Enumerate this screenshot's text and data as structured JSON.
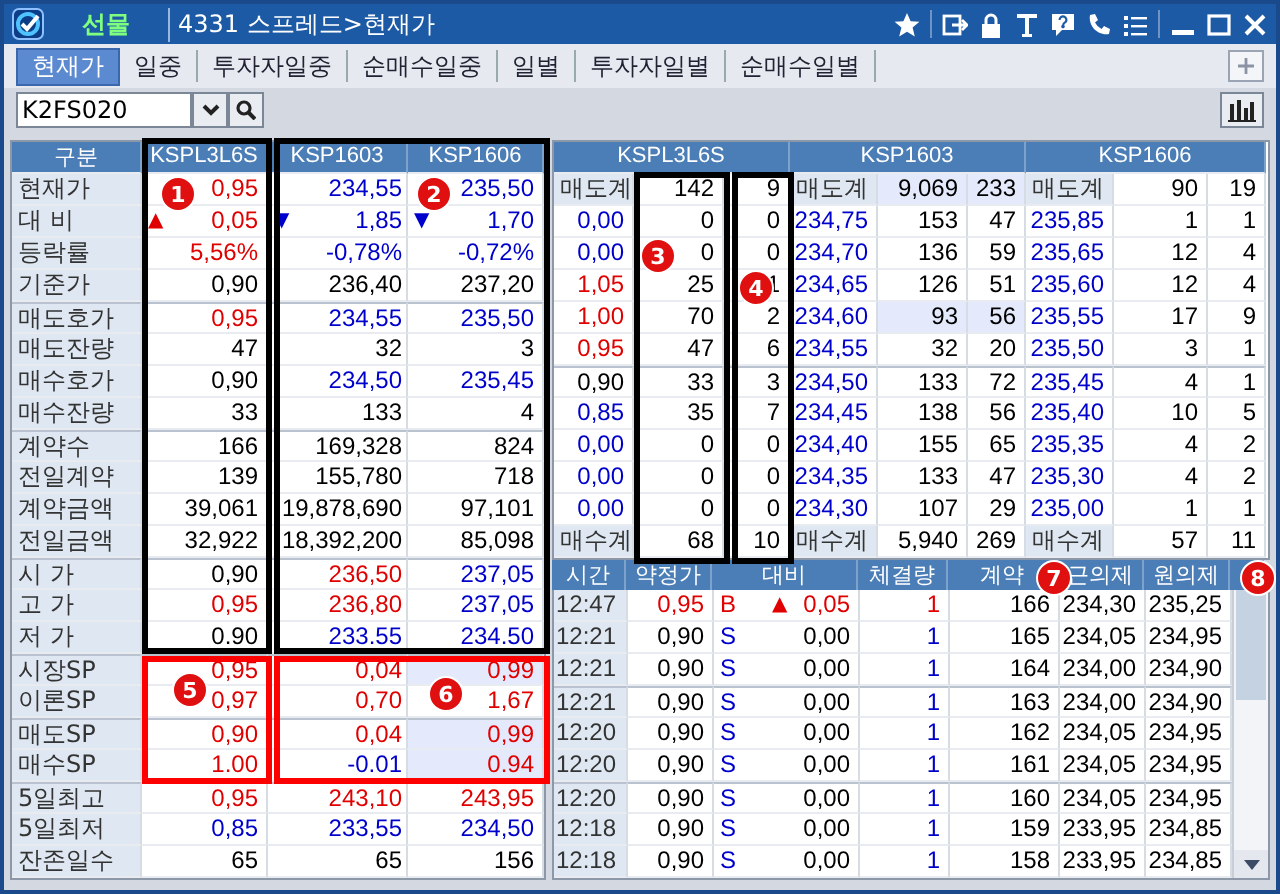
{
  "window": {
    "market": "선물",
    "title": "4331 스프레드>현재가"
  },
  "tabs": [
    {
      "label": "현재가",
      "selected": true
    },
    {
      "label": "일중",
      "selected": false
    },
    {
      "label": "투자자일중",
      "selected": false
    },
    {
      "label": "순매수일중",
      "selected": false
    },
    {
      "label": "일별",
      "selected": false
    },
    {
      "label": "투자자일별",
      "selected": false
    },
    {
      "label": "순매수일별",
      "selected": false
    }
  ],
  "toolbar": {
    "code": "K2FS020"
  },
  "quote_table": {
    "corner": "구분",
    "columns": [
      "KSPL3L6S",
      "KSP1603",
      "KSP1606"
    ],
    "rows": [
      {
        "label": "현재가",
        "cells": [
          {
            "text": "0,95",
            "color": "#e00000"
          },
          {
            "text": "234,55",
            "color": "#0000cc"
          },
          {
            "text": "235,50",
            "color": "#0000cc"
          }
        ]
      },
      {
        "label": "대 비",
        "cells": [
          {
            "text": "0,05",
            "color": "#e00000",
            "arrow": "▲"
          },
          {
            "text": "1,85",
            "color": "#0000cc",
            "arrow": "▼"
          },
          {
            "text": "1,70",
            "color": "#0000cc",
            "arrow": "▼"
          }
        ]
      },
      {
        "label": "등락률",
        "cells": [
          {
            "text": "5,56%",
            "color": "#e00000"
          },
          {
            "text": "-0,78%",
            "color": "#0000cc"
          },
          {
            "text": "-0,72%",
            "color": "#0000cc"
          }
        ]
      },
      {
        "label": "기준가",
        "cells": [
          "0,90",
          "236,40",
          "237,20"
        ]
      },
      {
        "label": "매도호가",
        "divider": true,
        "cells": [
          {
            "text": "0,95",
            "color": "#e00000"
          },
          {
            "text": "234,55",
            "color": "#0000cc"
          },
          {
            "text": "235,50",
            "color": "#0000cc"
          }
        ]
      },
      {
        "label": "매도잔량",
        "cells": [
          "47",
          "32",
          "3"
        ]
      },
      {
        "label": "매수호가",
        "cells": [
          "0,90",
          {
            "text": "234,50",
            "color": "#0000cc"
          },
          {
            "text": "235,45",
            "color": "#0000cc"
          }
        ]
      },
      {
        "label": "매수잔량",
        "cells": [
          "33",
          "133",
          "4"
        ]
      },
      {
        "label": "계약수",
        "divider": true,
        "cells": [
          "166",
          "169,328",
          "824"
        ]
      },
      {
        "label": "전일계약",
        "cells": [
          "139",
          "155,780",
          "718"
        ]
      },
      {
        "label": "계약금액",
        "cells": [
          "39,061",
          "19,878,690",
          "97,101"
        ]
      },
      {
        "label": "전일금액",
        "cells": [
          "32,922",
          "18,392,200",
          "85,098"
        ]
      },
      {
        "label": "시 가",
        "divider": true,
        "cells": [
          "0,90",
          {
            "text": "236,50",
            "color": "#e00000"
          },
          {
            "text": "237,05",
            "color": "#0000cc"
          }
        ]
      },
      {
        "label": "고 가",
        "cells": [
          {
            "text": "0,95",
            "color": "#e00000"
          },
          {
            "text": "236,80",
            "color": "#e00000"
          },
          {
            "text": "237,05",
            "color": "#0000cc"
          }
        ]
      },
      {
        "label": "저 가",
        "cells": [
          "0.90",
          {
            "text": "233.55",
            "color": "#0000cc"
          },
          {
            "text": "234.50",
            "color": "#0000cc"
          }
        ]
      },
      {
        "label": "시장SP",
        "divider": true,
        "cells": [
          {
            "text": "0,95",
            "color": "#e00000"
          },
          {
            "text": "0,04",
            "color": "#e00000"
          },
          {
            "text": "0,99",
            "color": "#e00000",
            "highlighted": true
          }
        ]
      },
      {
        "label": "이론SP",
        "cells": [
          {
            "text": "0,97",
            "color": "#e00000"
          },
          {
            "text": "0,70",
            "color": "#e00000"
          },
          {
            "text": "1,67",
            "color": "#e00000"
          }
        ]
      },
      {
        "label": "매도SP",
        "divider": true,
        "cells": [
          {
            "text": "0,90",
            "color": "#e00000"
          },
          {
            "text": "0,04",
            "color": "#e00000"
          },
          {
            "text": "0,99",
            "color": "#e00000",
            "highlighted": true
          }
        ]
      },
      {
        "label": "매수SP",
        "cells": [
          {
            "text": "1.00",
            "color": "#e00000"
          },
          {
            "text": "-0.01",
            "color": "#0000cc"
          },
          {
            "text": "0.94",
            "color": "#e00000",
            "highlighted": true
          }
        ]
      },
      {
        "label": "5일최고",
        "divider": true,
        "cells": [
          {
            "text": "0,95",
            "color": "#e00000"
          },
          {
            "text": "243,10",
            "color": "#e00000"
          },
          {
            "text": "243,95",
            "color": "#e00000"
          }
        ]
      },
      {
        "label": "5일최저",
        "cells": [
          {
            "text": "0,85",
            "color": "#0000cc"
          },
          {
            "text": "233,55",
            "color": "#0000cc"
          },
          {
            "text": "234,50",
            "color": "#0000cc"
          }
        ]
      },
      {
        "label": "잔존일수",
        "cells": [
          "65",
          "65",
          "156"
        ]
      }
    ]
  },
  "order_book": {
    "column_groups": [
      {
        "label": "KSPL3L6S"
      },
      {
        "label": "KSP1603"
      },
      {
        "label": "KSP1606"
      }
    ],
    "rows": [
      {
        "kind": "total",
        "cells": [
          "매도계",
          "142",
          "9",
          "매도계",
          {
            "text": "9,069",
            "highlighted": true
          },
          {
            "text": "233",
            "highlighted": true
          },
          "매도계",
          "90",
          "19"
        ]
      },
      {
        "kind": "price",
        "cells": [
          {
            "text": "0,00",
            "color": "#0000cc"
          },
          "0",
          "0",
          {
            "text": "234,75",
            "color": "#0000cc"
          },
          "153",
          "47",
          {
            "text": "235,85",
            "color": "#0000cc"
          },
          "1",
          "1"
        ]
      },
      {
        "kind": "price",
        "cells": [
          {
            "text": "0,00",
            "color": "#0000cc"
          },
          "0",
          "0",
          {
            "text": "234,70",
            "color": "#0000cc"
          },
          "136",
          "59",
          {
            "text": "235,65",
            "color": "#0000cc"
          },
          "12",
          "4"
        ]
      },
      {
        "kind": "price",
        "cells": [
          {
            "text": "1,05",
            "color": "#e00000"
          },
          "25",
          "1",
          {
            "text": "234,65",
            "color": "#0000cc"
          },
          "126",
          "51",
          {
            "text": "235,60",
            "color": "#0000cc"
          },
          "12",
          "4"
        ]
      },
      {
        "kind": "price",
        "cells": [
          {
            "text": "1,00",
            "color": "#e00000"
          },
          "70",
          "2",
          {
            "text": "234,60",
            "color": "#0000cc"
          },
          {
            "text": "93",
            "highlighted": true
          },
          {
            "text": "56",
            "highlighted": true
          },
          {
            "text": "235,55",
            "color": "#0000cc"
          },
          "17",
          "9"
        ]
      },
      {
        "kind": "price",
        "cells": [
          {
            "text": "0,95",
            "color": "#e00000"
          },
          "47",
          "6",
          {
            "text": "234,55",
            "color": "#0000cc"
          },
          "32",
          "20",
          {
            "text": "235,50",
            "color": "#0000cc"
          },
          "3",
          "1"
        ]
      },
      {
        "kind": "price",
        "divider": true,
        "cells": [
          "0,90",
          "33",
          "3",
          {
            "text": "234,50",
            "color": "#0000cc"
          },
          "133",
          "72",
          {
            "text": "235,45",
            "color": "#0000cc"
          },
          "4",
          "1"
        ]
      },
      {
        "kind": "price",
        "cells": [
          {
            "text": "0,85",
            "color": "#0000cc"
          },
          "35",
          "7",
          {
            "text": "234,45",
            "color": "#0000cc"
          },
          "138",
          "56",
          {
            "text": "235,40",
            "color": "#0000cc"
          },
          "10",
          "5"
        ]
      },
      {
        "kind": "price",
        "cells": [
          {
            "text": "0,00",
            "color": "#0000cc"
          },
          "0",
          "0",
          {
            "text": "234,40",
            "color": "#0000cc"
          },
          "155",
          "65",
          {
            "text": "235,35",
            "color": "#0000cc"
          },
          "4",
          "2"
        ]
      },
      {
        "kind": "price",
        "cells": [
          {
            "text": "0,00",
            "color": "#0000cc"
          },
          "0",
          "0",
          {
            "text": "234,35",
            "color": "#0000cc"
          },
          "133",
          "47",
          {
            "text": "235,30",
            "color": "#0000cc"
          },
          "4",
          "2"
        ]
      },
      {
        "kind": "price",
        "cells": [
          {
            "text": "0,00",
            "color": "#0000cc"
          },
          "0",
          "0",
          {
            "text": "234,30",
            "color": "#0000cc"
          },
          "107",
          "29",
          {
            "text": "235,00",
            "color": "#0000cc"
          },
          "1",
          "1"
        ]
      },
      {
        "kind": "total",
        "cells": [
          "매수계",
          "68",
          "10",
          "매수계",
          "5,940",
          "269",
          "매수계",
          "57",
          "11"
        ]
      }
    ]
  },
  "trades": {
    "columns": [
      "시간",
      "약정가",
      "대비",
      "체결량",
      "계약",
      "근의제",
      "원의제"
    ],
    "rows": [
      {
        "time": "12:47",
        "price": {
          "text": "0,95",
          "color": "#e00000"
        },
        "side": {
          "text": "B",
          "color": "#e00000"
        },
        "change": {
          "text": "0,05",
          "color": "#e00000",
          "arrow": "▲"
        },
        "volume": {
          "text": "1",
          "color": "#e00000"
        },
        "count": "166",
        "near": "234,30",
        "far": "235,25"
      },
      {
        "time": "12:21",
        "price": "0,90",
        "side": {
          "text": "S",
          "color": "#0000cc"
        },
        "change": "0,00",
        "volume": {
          "text": "1",
          "color": "#0000cc"
        },
        "count": "165",
        "near": "234,05",
        "far": "234,95"
      },
      {
        "time": "12:21",
        "price": "0,90",
        "side": {
          "text": "S",
          "color": "#0000cc"
        },
        "change": "0,00",
        "volume": {
          "text": "1",
          "color": "#0000cc"
        },
        "count": "164",
        "near": "234,00",
        "far": "234,90"
      },
      {
        "time": "12:21",
        "divider": true,
        "price": "0,90",
        "side": {
          "text": "S",
          "color": "#0000cc"
        },
        "change": "0,00",
        "volume": {
          "text": "1",
          "color": "#0000cc"
        },
        "count": "163",
        "near": "234,00",
        "far": "234,90"
      },
      {
        "time": "12:20",
        "price": "0,90",
        "side": {
          "text": "S",
          "color": "#0000cc"
        },
        "change": "0,00",
        "volume": {
          "text": "1",
          "color": "#0000cc"
        },
        "count": "162",
        "near": "234,05",
        "far": "234,95"
      },
      {
        "time": "12:20",
        "price": "0,90",
        "side": {
          "text": "S",
          "color": "#0000cc"
        },
        "change": "0,00",
        "volume": {
          "text": "1",
          "color": "#0000cc"
        },
        "count": "161",
        "near": "234,05",
        "far": "234,95"
      },
      {
        "time": "12:20",
        "divider": true,
        "price": "0,90",
        "side": {
          "text": "S",
          "color": "#0000cc"
        },
        "change": "0,00",
        "volume": {
          "text": "1",
          "color": "#0000cc"
        },
        "count": "160",
        "near": "234,05",
        "far": "234,95"
      },
      {
        "time": "12:18",
        "price": "0,90",
        "side": {
          "text": "S",
          "color": "#0000cc"
        },
        "change": "0,00",
        "volume": {
          "text": "1",
          "color": "#0000cc"
        },
        "count": "159",
        "near": "233,95",
        "far": "234,85"
      },
      {
        "time": "12:18",
        "price": "0,90",
        "side": {
          "text": "S",
          "color": "#0000cc"
        },
        "change": "0,00",
        "volume": {
          "text": "1",
          "color": "#0000cc"
        },
        "count": "158",
        "near": "233,95",
        "far": "234,85"
      }
    ]
  },
  "frames": [
    {
      "color": "#000000"
    },
    {
      "color": "#000000"
    },
    {
      "color": "#ff0000"
    },
    {
      "color": "#ff0000"
    },
    {
      "color": "#000000"
    },
    {
      "color": "#000000"
    }
  ],
  "markers": [
    "1",
    "2",
    "3",
    "4",
    "5",
    "6",
    "7",
    "8"
  ]
}
